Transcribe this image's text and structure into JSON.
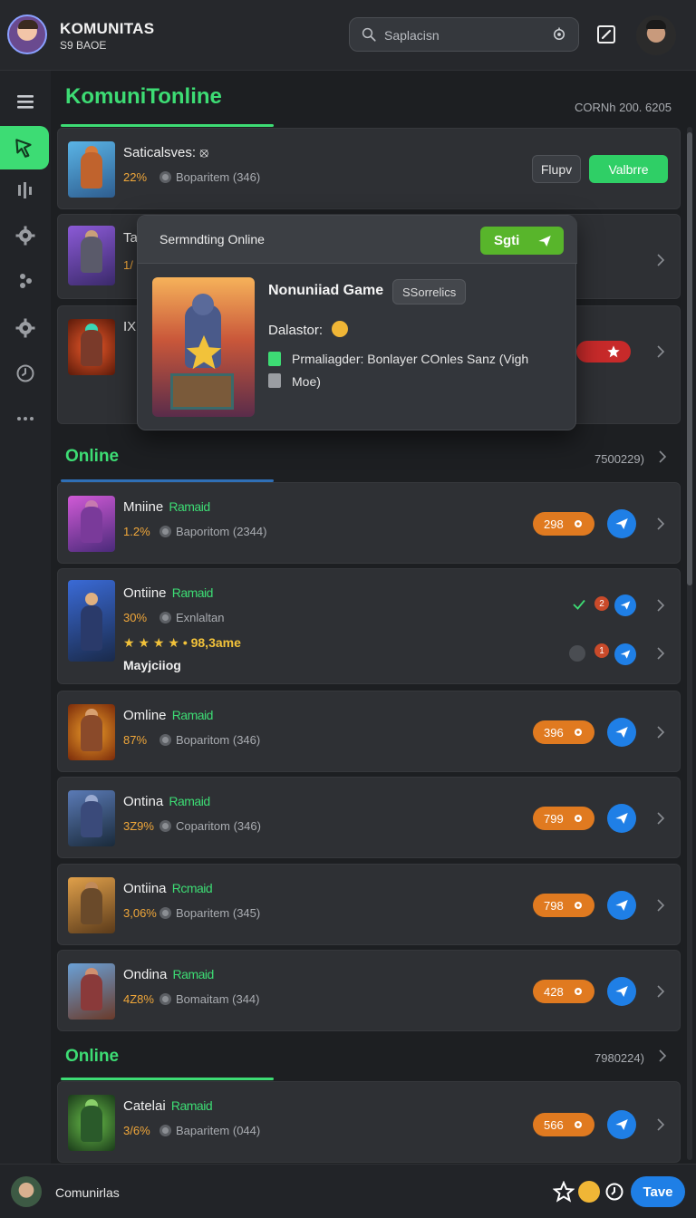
{
  "header": {
    "title": "KOMUNITAS",
    "subtitle": "S9 BAOE",
    "search_placeholder": "Saplacisn"
  },
  "page": {
    "title": "KomuniTonline",
    "meta": "CORNh 200. 6205"
  },
  "featured_card": {
    "name": "Saticalsves: ⦻",
    "pct": "22%",
    "team": "Boparitem (346)",
    "play_label": "Flupv",
    "valid_label": "Valbrre"
  },
  "partial_cards": [
    {
      "name": "Ta",
      "pct": "1/"
    },
    {
      "name": "IX"
    }
  ],
  "popover": {
    "title": "Sermndting Online",
    "action_label": "Sgti",
    "game_name": "Nonuniiad Game",
    "chip": "SSorrelics",
    "developer_label": "Dalastor:",
    "line1": "Prmaliagder: Bonlayer COnles Sanz (Vigh",
    "line2": "Moe)"
  },
  "section_online_1": {
    "title": "Online",
    "meta": "7500229)"
  },
  "games": [
    {
      "name": "Mniine",
      "tag": "Ramaid",
      "pct": "1.2%",
      "team": "Baporitom (2344)",
      "count": "298"
    },
    {
      "name": "Ontiine",
      "tag": "Ramaid",
      "pct": "30%",
      "team": "Exnlaltan",
      "rating_text": "• 98,3ame",
      "footer": "Mayjciiog",
      "badge_a": "2",
      "badge_b": "1"
    },
    {
      "name": "Omline",
      "tag": "Ramaid",
      "pct": "87%",
      "team": "Boparitom (346)",
      "count": "396"
    },
    {
      "name": "Ontina",
      "tag": "Ramaid",
      "pct": "3Z9%",
      "team": "Coparitom (346)",
      "count": "799"
    },
    {
      "name": "Ontiina",
      "tag": "Rcmaid",
      "pct": "3,06%",
      "team": "Boparitem (345)",
      "count": "798"
    },
    {
      "name": "Ondina",
      "tag": "Ramaid",
      "pct": "4Z8%",
      "team": "Bomaitam (344)",
      "count": "428"
    }
  ],
  "section_online_2": {
    "title": "Online",
    "meta": "7980224)"
  },
  "last_game": {
    "name": "Catelai",
    "tag": "Ramaid",
    "pct": "3/6%",
    "team": "Baparitem (044)",
    "count": "566"
  },
  "bottom": {
    "label": "Comunirlas",
    "button_label": "Tave"
  },
  "colors": {
    "accent_green": "#3ddc74",
    "accent_orange": "#e07a20",
    "accent_blue": "#1f7fe6",
    "background": "#1d1f22"
  },
  "icons": [
    "search-icon",
    "voice-icon",
    "edit-icon",
    "menu-icon",
    "pointer-icon",
    "equalizer-icon",
    "gear-icon",
    "people-icon",
    "clock-icon",
    "more-icon",
    "chevron-right-icon",
    "send-icon",
    "star-icon"
  ]
}
